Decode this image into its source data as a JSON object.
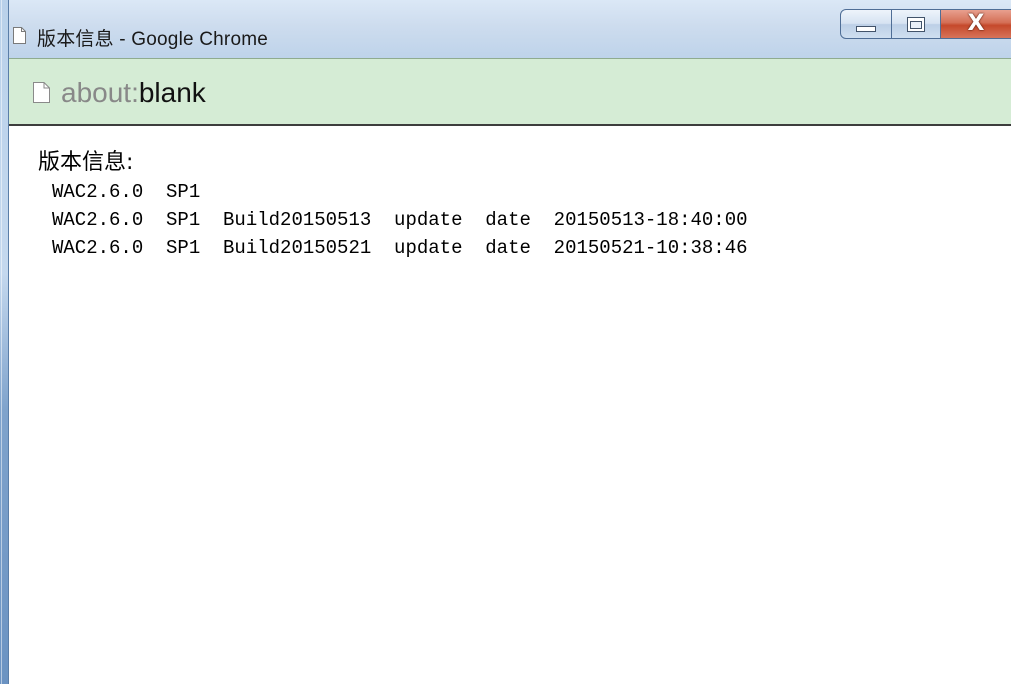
{
  "window": {
    "title": "版本信息 - Google Chrome",
    "close_glyph": "X"
  },
  "address_bar": {
    "scheme": "about:",
    "path": "blank"
  },
  "page": {
    "heading": "版本信息:",
    "lines": [
      "WAC2.6.0  SP1",
      "WAC2.6.0  SP1  Build20150513  update  date  20150513-18:40:00",
      "WAC2.6.0  SP1  Build20150521  update  date  20150521-10:38:46"
    ]
  },
  "icons": {
    "tab": "page-icon",
    "omnibox": "page-icon"
  },
  "colors": {
    "address_bar_bg": "#d5ecd5",
    "close_button": "#c5492b"
  }
}
